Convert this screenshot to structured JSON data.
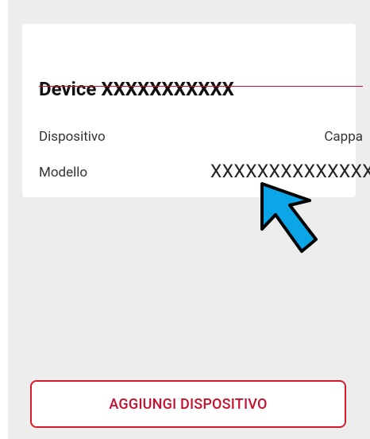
{
  "device_card": {
    "title": "Device XXXXXXXXXXX",
    "rows": [
      {
        "label": "Dispositivo",
        "value": "Cappa"
      },
      {
        "label": "Modello",
        "value": "XXXXXXXXXXXXXX"
      }
    ]
  },
  "annotation": {
    "icon": "arrow-pointer-icon",
    "color": "#0aa6e8"
  },
  "footer": {
    "add_button_label": "AGGIUNGI DISPOSITIVO"
  },
  "colors": {
    "accent": "#c8102e",
    "background": "#ededed",
    "card": "#ffffff"
  }
}
